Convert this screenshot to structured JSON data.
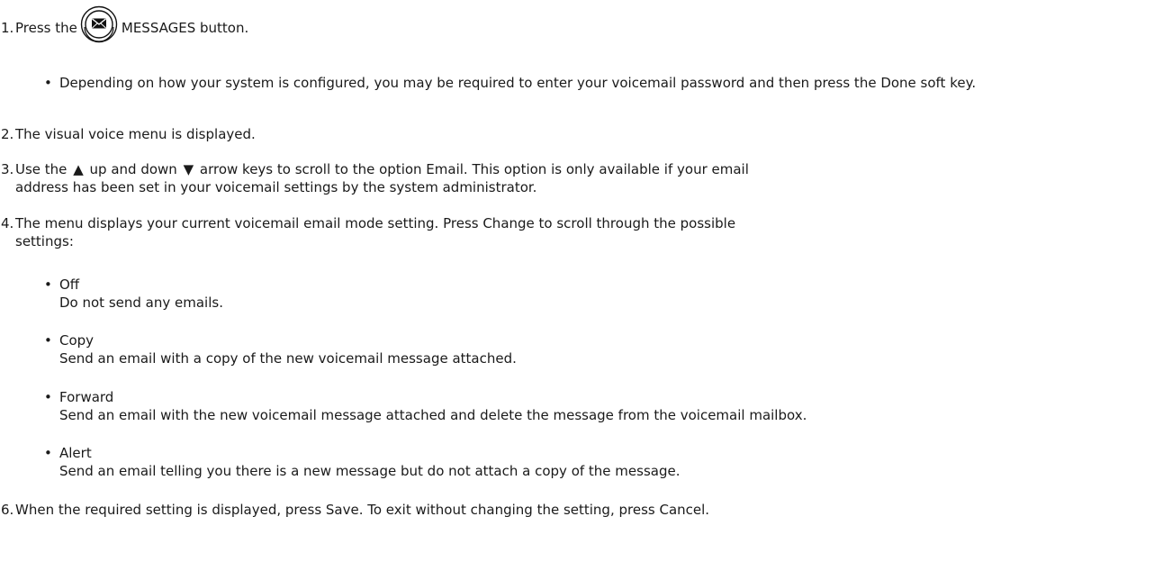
{
  "steps": [
    {
      "num": "1.",
      "text_before_icon": "Press the",
      "icon": "messages-envelope-icon",
      "text_after_icon": "MESSAGES button.",
      "note": "Depending on how your system is configured, you may be required to enter your voicemail password and then press the Done soft key."
    },
    {
      "num": "2.",
      "text": "The visual voice menu is displayed."
    },
    {
      "num": "3.",
      "part1": "Use the",
      "up_icon": "▲",
      "part2": "up and down",
      "down_icon": "▼",
      "part3": "arrow keys to scroll to the option Email. This option is only available if your email",
      "part4": "address has been set in your voicemail settings by the system administrator."
    },
    {
      "num": "4.",
      "line1": "The menu displays your current voicemail email mode setting. Press Change to scroll through the possible",
      "line2": "settings:",
      "options": [
        {
          "name": "Off",
          "desc": "Do not send any emails."
        },
        {
          "name": "Copy",
          "desc": "Send an email with a copy of the new voicemail message attached."
        },
        {
          "name": "Forward",
          "desc": "Send an email with the new voicemail message attached and delete the message from the voicemail mailbox."
        },
        {
          "name": "Alert",
          "desc": "Send an email telling you there is a new message but do not attach a copy of the message."
        }
      ]
    },
    {
      "num": "6.",
      "text": "When the required setting is displayed, press Save. To exit without changing the setting, press Cancel."
    }
  ],
  "bullet_char": "•"
}
